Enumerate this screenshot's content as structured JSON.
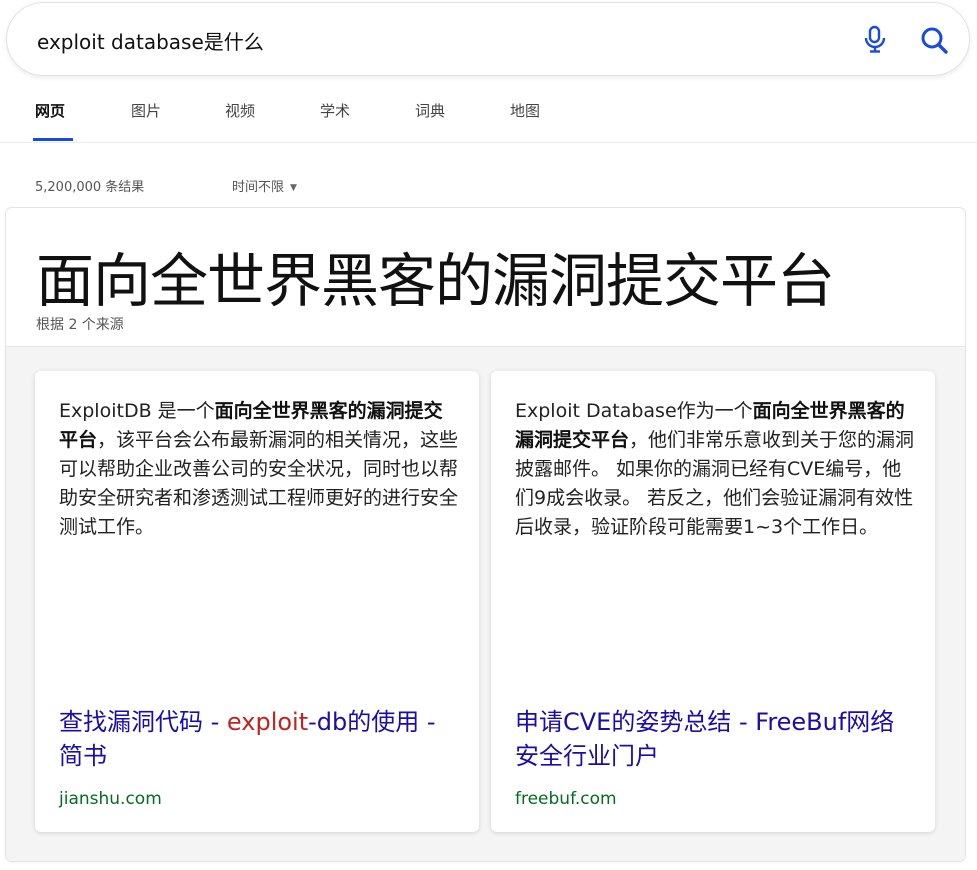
{
  "search": {
    "query": "exploit database是什么"
  },
  "icons": {
    "mic": "microphone-icon",
    "search": "search-icon",
    "caret": "caret-down-icon"
  },
  "colors": {
    "accent": "#174ae4",
    "link": "#1a0dab",
    "link_highlight": "#c5221f",
    "domain": "#006d21"
  },
  "tabs": [
    {
      "label": "网页",
      "active": true
    },
    {
      "label": "图片",
      "active": false
    },
    {
      "label": "视频",
      "active": false
    },
    {
      "label": "学术",
      "active": false
    },
    {
      "label": "词典",
      "active": false
    },
    {
      "label": "地图",
      "active": false
    }
  ],
  "results_meta": {
    "count": "5,200,000 条结果",
    "time_filter": "时间不限"
  },
  "answer": {
    "title": "面向全世界黑客的漏洞提交平台",
    "source_count": "根据 2 个来源",
    "sources": [
      {
        "snippet_pre": "ExploitDB 是一个",
        "snippet_bold": "面向全世界黑客的漏洞提交平台",
        "snippet_post": "，该平台会公布最新漏洞的相关情况，这些可以帮助企业改善公司的安全状况，同时也以帮助安全研究者和渗透测试工程师更好的进行安全测试工作。",
        "link_pre": "查找漏洞代码 - ",
        "link_highlight": "exploit",
        "link_post": "-db的使用 - 简书",
        "domain": "jianshu.com"
      },
      {
        "snippet_pre": "Exploit Database作为一个",
        "snippet_bold": "面向全世界黑客的漏洞提交平台",
        "snippet_post": "，他们非常乐意收到关于您的漏洞披露邮件。 如果你的漏洞已经有CVE编号，他们9成会收录。 若反之，他们会验证漏洞有效性后收录，验证阶段可能需要1~3个工作日。",
        "link_pre": "申请CVE的姿势总结 - FreeBuf网络安全行业门户",
        "link_highlight": "",
        "link_post": "",
        "domain": "freebuf.com"
      }
    ]
  }
}
